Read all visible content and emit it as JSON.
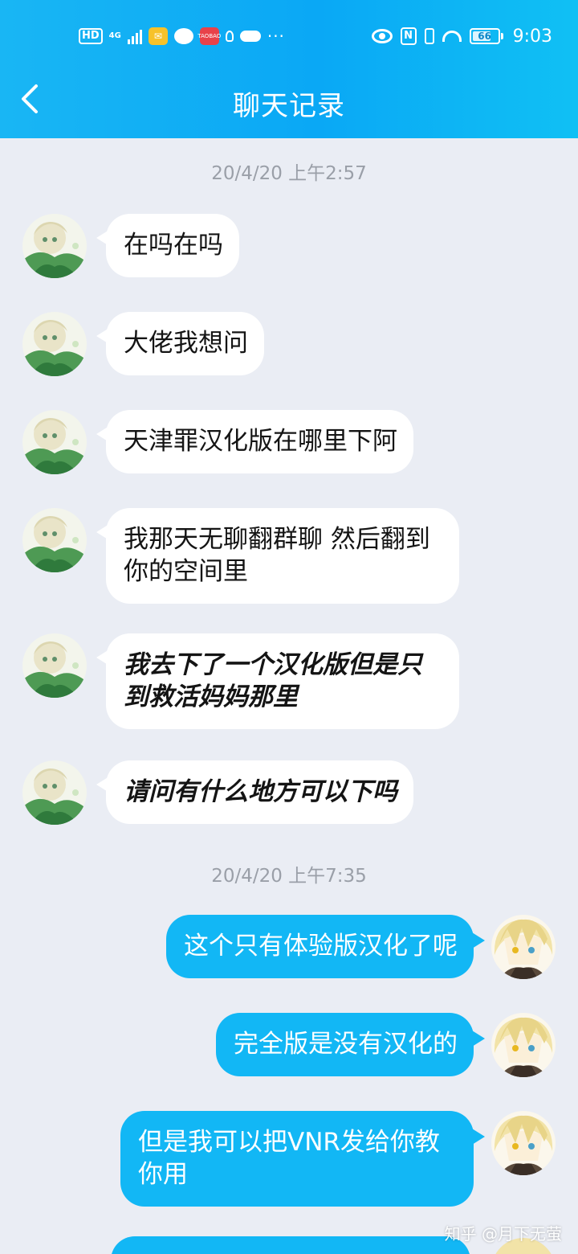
{
  "status_bar": {
    "hd_label": "HD",
    "network_label": "4G",
    "shop_icon_text": "TAOBAO",
    "dots": "···",
    "nfc_label": "N",
    "battery_level": "66",
    "time": "9:03"
  },
  "title_bar": {
    "title": "聊天记录"
  },
  "colors": {
    "header_gradient_start": "#19b6f4",
    "header_gradient_end": "#10c0f4",
    "chat_background": "#eaedf4",
    "incoming_bubble": "#ffffff",
    "outgoing_bubble": "#12b7f5"
  },
  "conversation": {
    "timestamps": [
      "20/4/20 上午2:57",
      "20/4/20 上午7:35"
    ],
    "messages": [
      {
        "side": "left",
        "text": "在吗在吗"
      },
      {
        "side": "left",
        "text": "大佬我想问"
      },
      {
        "side": "left",
        "text": "天津罪汉化版在哪里下阿"
      },
      {
        "side": "left",
        "text": "我那天无聊翻群聊 然后翻到你的空间里"
      },
      {
        "side": "left",
        "text": "我去下了一个汉化版但是只到救活妈妈那里"
      },
      {
        "side": "left",
        "text": "请问有什么地方可以下吗"
      },
      {
        "side": "right",
        "text": "这个只有体验版汉化了呢"
      },
      {
        "side": "right",
        "text": "完全版是没有汉化的"
      },
      {
        "side": "right",
        "text": "但是我可以把VNR发给你教你用"
      }
    ]
  },
  "watermark": "知乎 @月下无萤"
}
